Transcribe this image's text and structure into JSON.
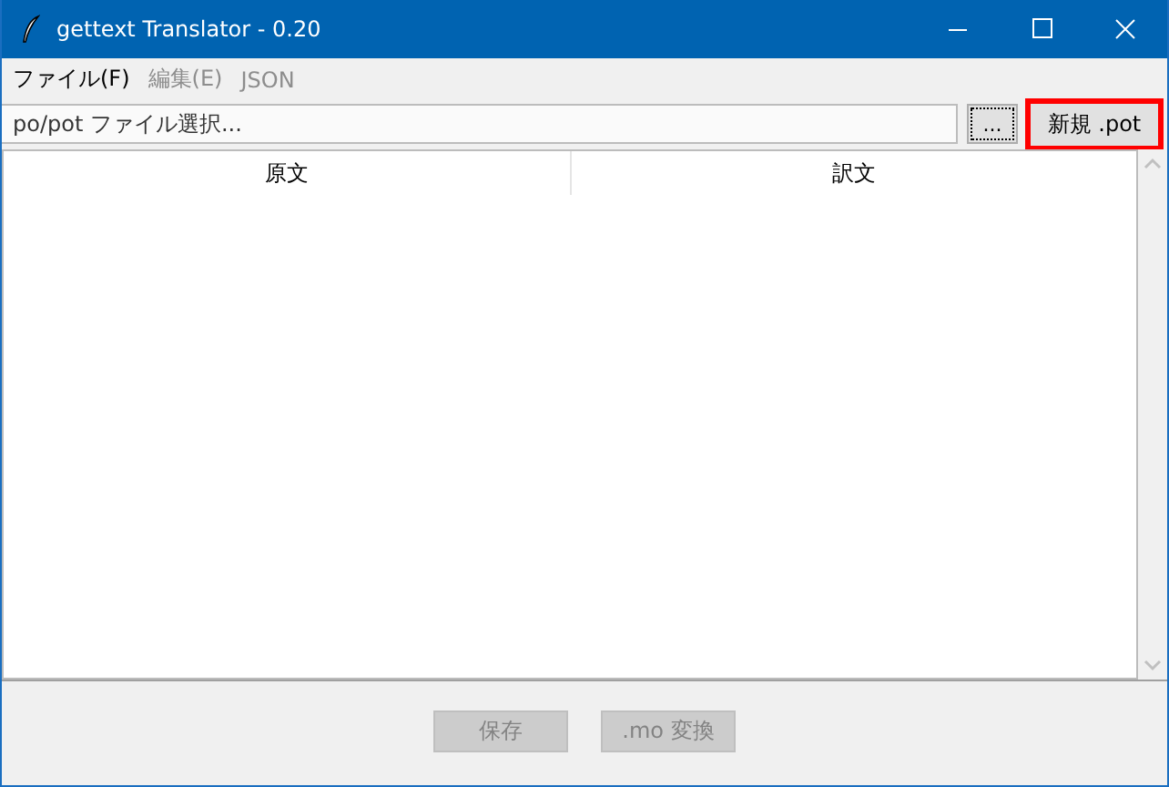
{
  "window": {
    "title": "gettext Translator - 0.20"
  },
  "menu": [
    {
      "label": "ファイル(F)",
      "disabled": false
    },
    {
      "label": "編集(E)",
      "disabled": true
    },
    {
      "label": "JSON",
      "disabled": true
    }
  ],
  "file_field": {
    "placeholder": "po/pot ファイル選択..."
  },
  "browse_button": {
    "label": "...",
    "focused": true
  },
  "new_button": {
    "label": "新規 .pot",
    "highlighted": true
  },
  "table": {
    "columns": [
      "原文",
      "訳文"
    ]
  },
  "buttons": [
    {
      "label": "保存",
      "disabled": true
    },
    {
      "label": ".mo 変換",
      "disabled": true
    }
  ]
}
